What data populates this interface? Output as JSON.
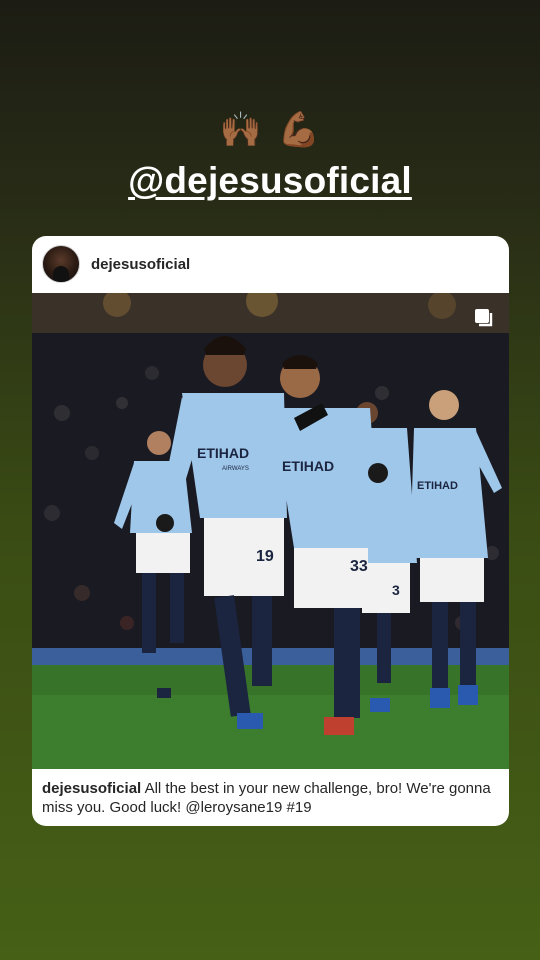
{
  "story": {
    "emojis": [
      "🙌🏾",
      "💪🏾"
    ],
    "mention": "@dejesusoficial"
  },
  "post": {
    "username": "dejesusoficial",
    "caption_user": "dejesusoficial",
    "caption_text": "All the best in your new challenge, bro! We're gonna miss you. Good luck! @leroysane19 #19",
    "photo": {
      "sponsor_text": "ETIHAD",
      "sponsor_sub": "AIRWAYS",
      "numbers": [
        "19",
        "33",
        "3"
      ]
    }
  },
  "colors": {
    "kit_blue": "#9fc7ea",
    "pitch_green": "#3b7d2f",
    "shorts_white": "#f2f2f2",
    "socks_navy": "#1b2540"
  },
  "icons": {
    "multi_photo": "carousel-icon"
  }
}
